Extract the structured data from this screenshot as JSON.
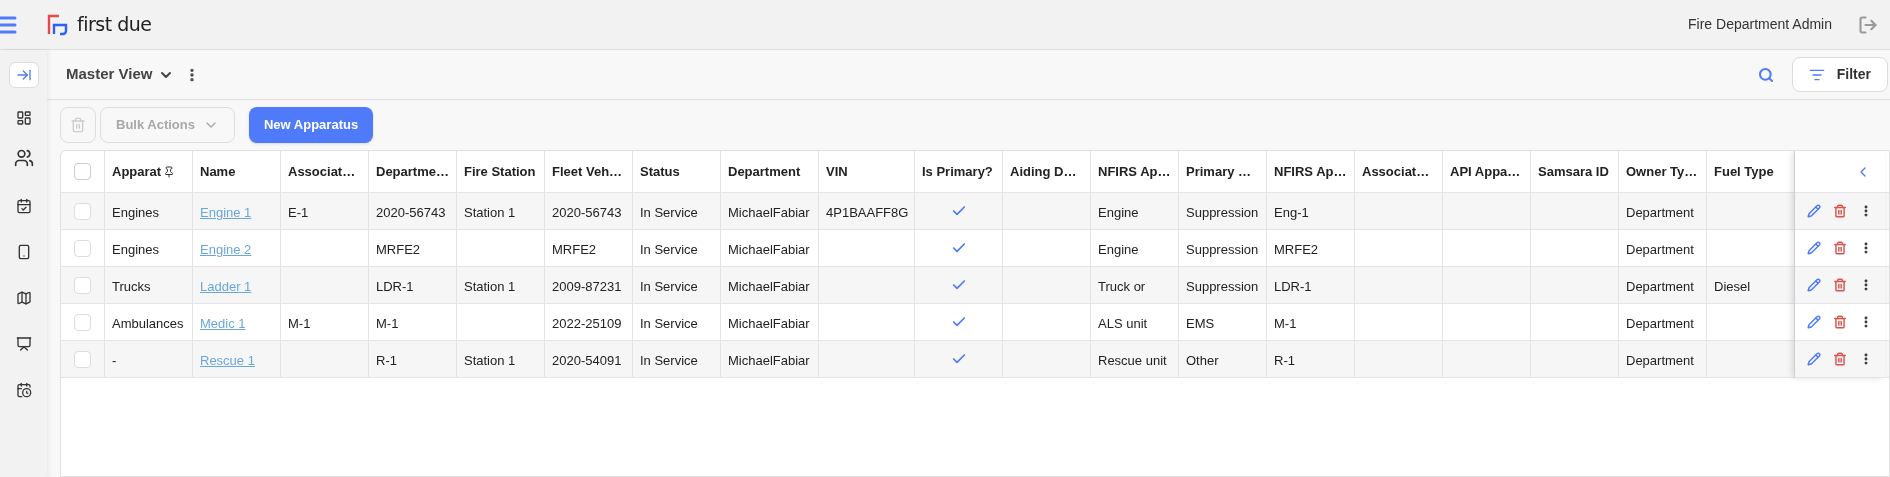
{
  "header": {
    "app_name": "first due",
    "user": "Fire Department Admin"
  },
  "view": {
    "title": "Master View"
  },
  "toolbar": {
    "delete_disabled": true,
    "bulk_actions": "Bulk Actions",
    "bulk_disabled": true,
    "new_button": "New Apparatus",
    "filter": "Filter"
  },
  "table": {
    "select_all": false,
    "columns": [
      {
        "label": "Apparat",
        "kind": "text",
        "pinned": true
      },
      {
        "label": "Name",
        "kind": "link"
      },
      {
        "label": "Associat…",
        "kind": "text"
      },
      {
        "label": "Departme…",
        "kind": "text"
      },
      {
        "label": "Fire Station",
        "kind": "text"
      },
      {
        "label": "Fleet Veh…",
        "kind": "text"
      },
      {
        "label": "Status",
        "kind": "text"
      },
      {
        "label": "Department",
        "kind": "text"
      },
      {
        "label": "VIN",
        "kind": "text"
      },
      {
        "label": "Is Primary?",
        "kind": "check"
      },
      {
        "label": "Aiding D…",
        "kind": "text"
      },
      {
        "label": "NFIRS Ap…",
        "kind": "text"
      },
      {
        "label": "Primary …",
        "kind": "text"
      },
      {
        "label": "NFIRS Ap…",
        "kind": "text"
      },
      {
        "label": "Associat…",
        "kind": "text"
      },
      {
        "label": "API Appa…",
        "kind": "text"
      },
      {
        "label": "Samsara ID",
        "kind": "text"
      },
      {
        "label": "Owner Ty…",
        "kind": "text"
      },
      {
        "label": "Fuel Type",
        "kind": "text"
      }
    ],
    "rows": [
      {
        "selected": false,
        "cells": [
          {
            "text": "Engines"
          },
          {
            "text": "Engine 1"
          },
          {
            "text": "E-1"
          },
          {
            "text": "2020-56743"
          },
          {
            "text": "Station 1"
          },
          {
            "text": "2020-56743"
          },
          {
            "text": "In Service"
          },
          {
            "text": "MichaelFabiar"
          },
          {
            "text": "4P1BAAFF8G"
          },
          {
            "checked": true
          },
          {},
          {
            "text": "Engine"
          },
          {
            "text": "Suppression"
          },
          {
            "text": "Eng-1"
          },
          {},
          {},
          {},
          {
            "text": "Department"
          },
          {}
        ]
      },
      {
        "selected": false,
        "cells": [
          {
            "text": "Engines"
          },
          {
            "text": "Engine 2"
          },
          {},
          {
            "text": "MRFE2"
          },
          {},
          {
            "text": "MRFE2"
          },
          {
            "text": "In Service"
          },
          {
            "text": "MichaelFabiar"
          },
          {},
          {
            "checked": true
          },
          {},
          {
            "text": "Engine"
          },
          {
            "text": "Suppression"
          },
          {
            "text": "MRFE2"
          },
          {},
          {},
          {},
          {
            "text": "Department"
          },
          {}
        ]
      },
      {
        "selected": false,
        "cells": [
          {
            "text": "Trucks"
          },
          {
            "text": "Ladder 1"
          },
          {},
          {
            "text": "LDR-1"
          },
          {
            "text": "Station 1"
          },
          {
            "text": "2009-87231"
          },
          {
            "text": "In Service"
          },
          {
            "text": "MichaelFabiar"
          },
          {},
          {
            "checked": true
          },
          {},
          {
            "text": "Truck or"
          },
          {
            "text": "Suppression"
          },
          {
            "text": "LDR-1"
          },
          {},
          {},
          {},
          {
            "text": "Department"
          },
          {
            "text": "Diesel"
          }
        ]
      },
      {
        "selected": false,
        "cells": [
          {
            "text": "Ambulances"
          },
          {
            "text": "Medic 1"
          },
          {
            "text": "M-1"
          },
          {
            "text": "M-1"
          },
          {},
          {
            "text": "2022-25109"
          },
          {
            "text": "In Service"
          },
          {
            "text": "MichaelFabiar"
          },
          {},
          {
            "checked": true
          },
          {},
          {
            "text": "ALS unit"
          },
          {
            "text": "EMS"
          },
          {
            "text": "M-1"
          },
          {},
          {},
          {},
          {
            "text": "Department"
          },
          {}
        ]
      },
      {
        "selected": false,
        "cells": [
          {
            "text": "-"
          },
          {
            "text": "Rescue 1"
          },
          {},
          {
            "text": "R-1"
          },
          {
            "text": "Station 1"
          },
          {
            "text": "2020-54091"
          },
          {
            "text": "In Service"
          },
          {
            "text": "MichaelFabiar"
          },
          {},
          {
            "checked": true
          },
          {},
          {
            "text": "Rescue unit"
          },
          {
            "text": "Other"
          },
          {
            "text": "R-1"
          },
          {},
          {},
          {},
          {
            "text": "Department"
          },
          {}
        ]
      }
    ]
  }
}
